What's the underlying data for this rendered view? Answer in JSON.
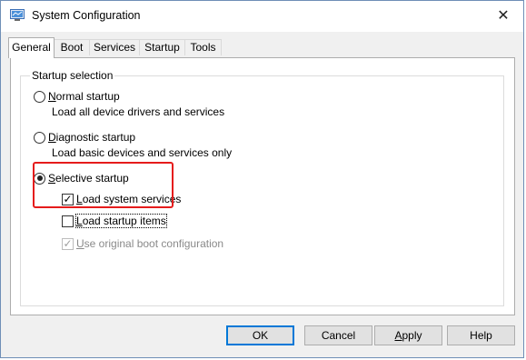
{
  "window": {
    "title": "System Configuration",
    "close_glyph": "✕"
  },
  "tabs": [
    {
      "label": "General",
      "active": true
    },
    {
      "label": "Boot",
      "active": false
    },
    {
      "label": "Services",
      "active": false
    },
    {
      "label": "Startup",
      "active": false
    },
    {
      "label": "Tools",
      "active": false
    }
  ],
  "startup_selection": {
    "legend": "Startup selection",
    "normal": {
      "label_first": "N",
      "label_rest": "ormal startup",
      "description": "Load all device drivers and services",
      "checked": false
    },
    "diagnostic": {
      "label_first": "D",
      "label_rest": "iagnostic startup",
      "description": "Load basic devices and services only",
      "checked": false
    },
    "selective": {
      "label_first": "S",
      "label_rest": "elective startup",
      "checked": true
    },
    "options": {
      "load_system_services": {
        "label_first": "L",
        "label_rest": "oad system services",
        "checked": true,
        "enabled": true
      },
      "load_startup_items": {
        "label_first": "L",
        "label_rest": "oad startup items",
        "checked": false,
        "enabled": true
      },
      "use_original_boot": {
        "label_first": "U",
        "label_rest": "se original boot configuration",
        "checked": true,
        "enabled": false
      }
    }
  },
  "buttons": {
    "ok": "OK",
    "cancel": "Cancel",
    "apply_first": "A",
    "apply_rest": "pply",
    "help": "Help"
  },
  "colors": {
    "highlight": "#e51c1c",
    "default_button_border": "#0078d7"
  },
  "icons": {
    "app": "system-configuration-icon",
    "check": "✓"
  }
}
